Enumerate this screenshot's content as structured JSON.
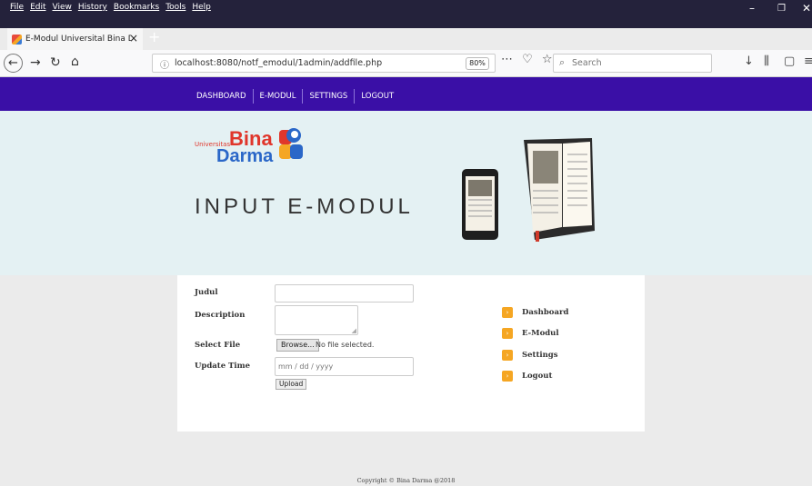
{
  "browser": {
    "menu": [
      "File",
      "Edit",
      "View",
      "History",
      "Bookmarks",
      "Tools",
      "Help"
    ],
    "tab_title": "E-Modul Universital Bina Darm",
    "url": "localhost:8080/notf_emodul/1admin/addfile.php",
    "zoom": "80%",
    "search_placeholder": "Search"
  },
  "site": {
    "nav": [
      "DASHBOARD",
      "E-MODUL",
      "SETTINGS",
      "LOGOUT"
    ],
    "logo": {
      "small": "Universitas",
      "bina": "Bina",
      "darma": "Darma"
    },
    "hero_title": "INPUT E-MODUL"
  },
  "form": {
    "judul_label": "Judul",
    "description_label": "Description",
    "select_file_label": "Select File",
    "update_time_label": "Update Time",
    "browse_button": "Browse...",
    "no_file_text": "No file selected.",
    "date_placeholder": "mm / dd / yyyy",
    "upload_button": "Upload"
  },
  "sidebar": [
    "Dashboard",
    "E-Modul",
    "Settings",
    "Logout"
  ],
  "footer": "Copyright © Bina Darma @2018",
  "colors": {
    "nav_bg": "#3a0fa6",
    "hero_bg": "#e4f1f3",
    "accent": "#f5a623"
  }
}
